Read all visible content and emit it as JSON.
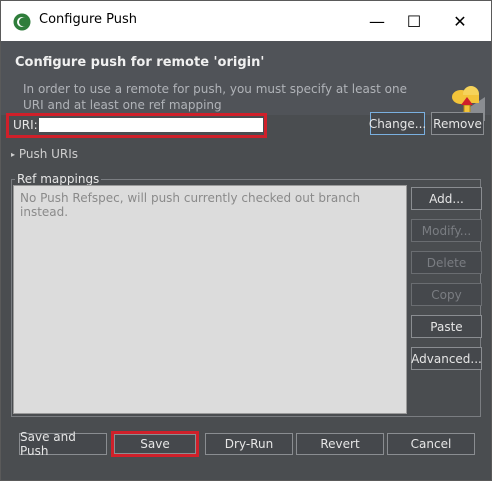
{
  "window": {
    "title": "Configure Push",
    "controls": {
      "minimize": "—",
      "maximize": "☐",
      "close": "✕"
    }
  },
  "header": {
    "title": "Configure push for remote 'origin'",
    "description": "In order to use a remote for push, you must specify at least one URI and at least one ref mapping"
  },
  "uri": {
    "label": "URI:",
    "value": "",
    "change_button": "Change...",
    "remove_button": "Remove"
  },
  "push_uris": {
    "label": "Push URIs"
  },
  "ref_mappings": {
    "legend": "Ref mappings",
    "placeholder_text": "No Push Refspec, will push currently checked out branch instead.",
    "buttons": {
      "add": "Add...",
      "modify": "Modify...",
      "delete": "Delete",
      "copy": "Copy",
      "paste": "Paste",
      "advanced": "Advanced..."
    }
  },
  "footer": {
    "save_and_push": "Save and Push",
    "save": "Save",
    "dry_run": "Dry-Run",
    "revert": "Revert",
    "cancel": "Cancel"
  },
  "colors": {
    "highlight": "#d0202a",
    "header_bg": "#505358",
    "body_bg": "#4a4d50"
  }
}
